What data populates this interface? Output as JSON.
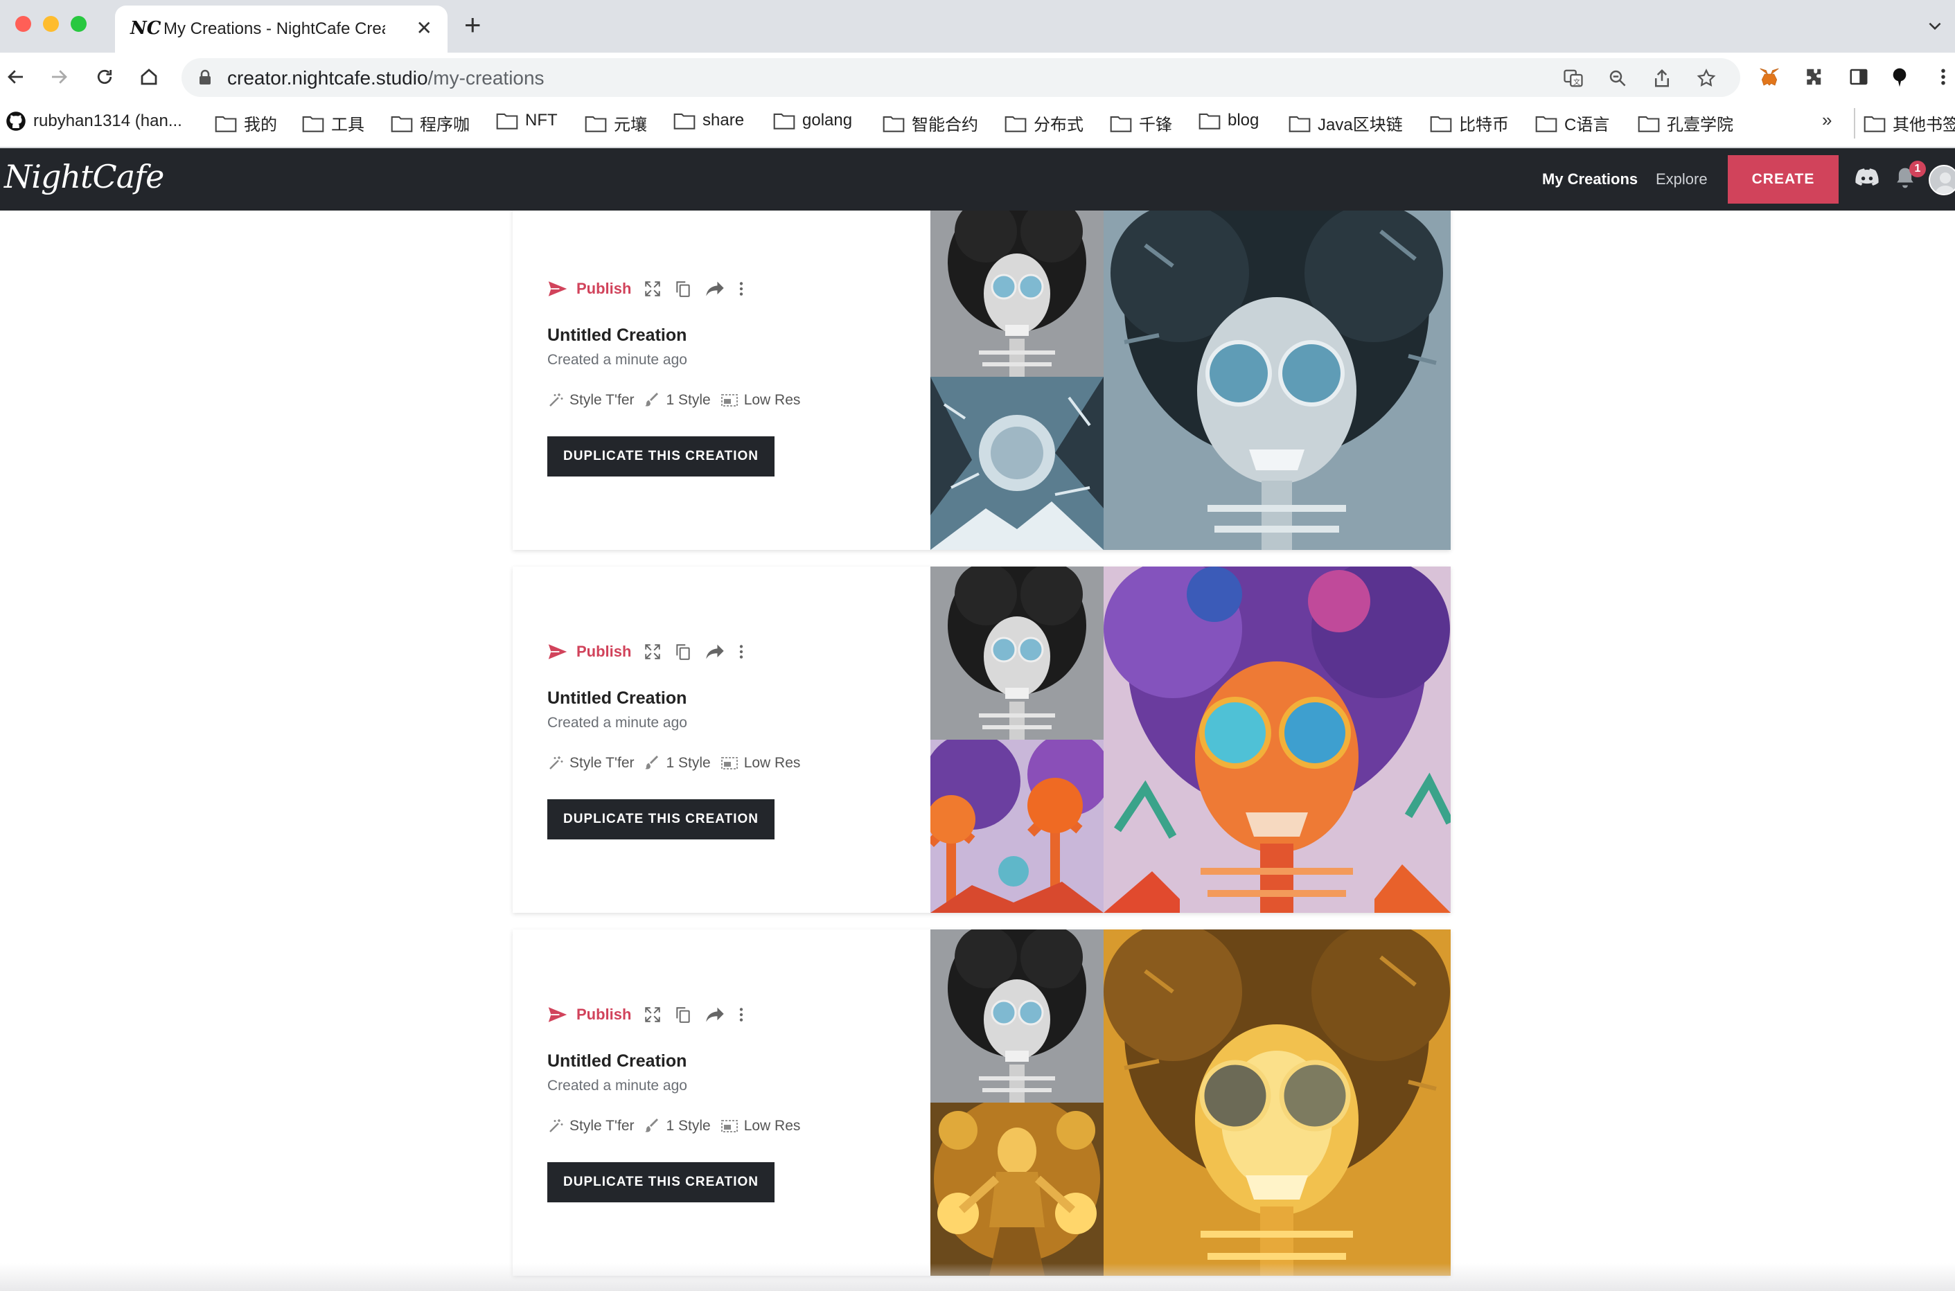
{
  "browser": {
    "tab_title": "My Creations - NightCafe Creator",
    "tab_favicon": "NC",
    "new_tab": "+",
    "close": "✕",
    "url_domain": "creator.nightcafe.studio",
    "url_path": "/my-creations",
    "bookmarks": [
      {
        "label": "rubyhan1314 (han...",
        "icon": "github-icon"
      },
      {
        "label": "我的",
        "icon": "folder-icon"
      },
      {
        "label": "工具",
        "icon": "folder-icon"
      },
      {
        "label": "程序咖",
        "icon": "folder-icon"
      },
      {
        "label": "NFT",
        "icon": "folder-icon"
      },
      {
        "label": "元壤",
        "icon": "folder-icon"
      },
      {
        "label": "share",
        "icon": "folder-icon"
      },
      {
        "label": "golang",
        "icon": "folder-icon"
      },
      {
        "label": "智能合约",
        "icon": "folder-icon"
      },
      {
        "label": "分布式",
        "icon": "folder-icon"
      },
      {
        "label": "千锋",
        "icon": "folder-icon"
      },
      {
        "label": "blog",
        "icon": "folder-icon"
      },
      {
        "label": "Java区块链",
        "icon": "folder-icon"
      },
      {
        "label": "比特币",
        "icon": "folder-icon"
      },
      {
        "label": "C语言",
        "icon": "folder-icon"
      },
      {
        "label": "孔壹学院",
        "icon": "folder-icon"
      }
    ],
    "bookmarks_more": "»",
    "other_bookmarks": "其他书签"
  },
  "app": {
    "logo": "NightCafe",
    "nav": {
      "my_creations": "My Creations",
      "explore": "Explore",
      "create": "CREATE"
    },
    "notification_count": "1",
    "accent_color": "#d1435b",
    "header_color": "#23262b"
  },
  "creations": [
    {
      "publish_label": "Publish",
      "title": "Untitled Creation",
      "created": "Created a minute ago",
      "meta": {
        "algorithm": "Style T'fer",
        "styles": "1 Style",
        "resolution": "Low Res"
      },
      "duplicate_label": "DUPLICATE THIS CREATION",
      "palette": "grey-blue"
    },
    {
      "publish_label": "Publish",
      "title": "Untitled Creation",
      "created": "Created a minute ago",
      "meta": {
        "algorithm": "Style T'fer",
        "styles": "1 Style",
        "resolution": "Low Res"
      },
      "duplicate_label": "DUPLICATE THIS CREATION",
      "palette": "colorful"
    },
    {
      "publish_label": "Publish",
      "title": "Untitled Creation",
      "created": "Created a minute ago",
      "meta": {
        "algorithm": "Style T'fer",
        "styles": "1 Style",
        "resolution": "Low Res"
      },
      "duplicate_label": "DUPLICATE THIS CREATION",
      "palette": "gold"
    }
  ]
}
